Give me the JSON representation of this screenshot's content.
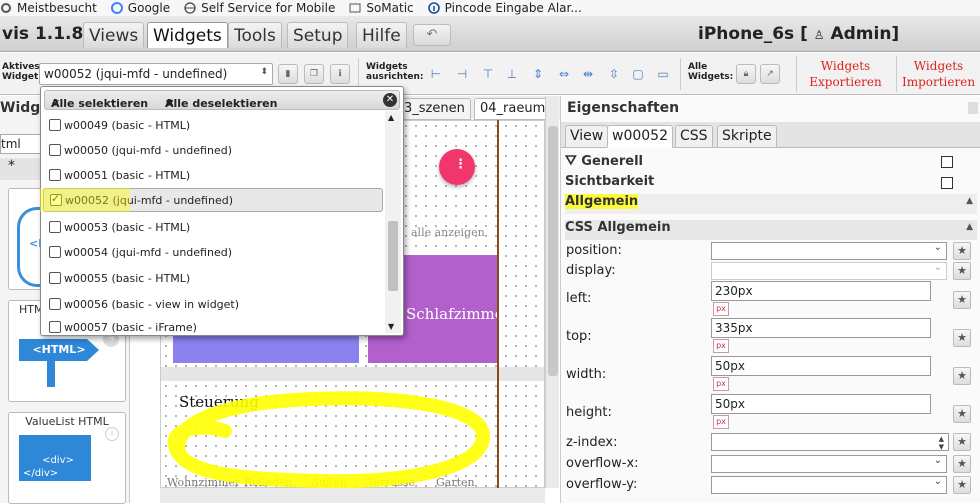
{
  "bookmarks": [
    {
      "label": "Meistbesucht",
      "icon": "gear-icon"
    },
    {
      "label": "Google",
      "icon": "google-icon"
    },
    {
      "label": "Self Service for Mobile",
      "icon": "globe-icon"
    },
    {
      "label": "SoMatic",
      "icon": "folder-icon"
    },
    {
      "label": "Pincode Eingabe Alar...",
      "icon": "info-icon"
    }
  ],
  "app": {
    "title": "vis 1.1.8",
    "menu": [
      "Views",
      "Widgets",
      "Tools",
      "Setup",
      "Hilfe"
    ],
    "active_menu": "Widgets",
    "undo_glyph": "↶",
    "project": "iPhone_6s [",
    "user": "Admin]"
  },
  "toolbar": {
    "active_widget_label_1": "Aktives",
    "active_widget_label_2": "Widget:",
    "active_widget_value": "w00052 (jqui-mfd - undefined)",
    "align_label_1": "Widgets",
    "align_label_2": "ausrichten:",
    "all_widgets_label_1": "Alle",
    "all_widgets_label_2": "Widgets:",
    "export_1": "Widgets",
    "export_2": "Exportieren",
    "import_1": "Widgets",
    "import_2": "Importieren"
  },
  "left_panel": {
    "title": "Widge",
    "filter_value": "tml",
    "star": "*",
    "cards": [
      {
        "label": "",
        "icon_text": "<I"
      },
      {
        "label": "HTM",
        "icon_text": "<HTML>"
      },
      {
        "label": "ValueList HTML",
        "icon_text": "<div>\n</div>"
      }
    ]
  },
  "dropdown": {
    "select_all": "Alle selektieren",
    "deselect_all": "Alle deselektieren",
    "items": [
      {
        "label": "w00049 (basic - HTML)",
        "checked": false
      },
      {
        "label": "w00050 (jqui-mfd - undefined)",
        "checked": false
      },
      {
        "label": "w00051 (basic - HTML)",
        "checked": false
      },
      {
        "label": "w00052 (jqui-mfd - undefined)",
        "checked": true
      },
      {
        "label": "w00053 (basic - HTML)",
        "checked": false
      },
      {
        "label": "w00054 (jqui-mfd - undefined)",
        "checked": false
      },
      {
        "label": "w00055 (basic - HTML)",
        "checked": false
      },
      {
        "label": "w00056 (basic - view in widget)",
        "checked": false
      },
      {
        "label": "w00057 (basic - iFrame)",
        "checked": false
      }
    ]
  },
  "views": {
    "tabs": [
      "3_szenen",
      "04_raeume"
    ]
  },
  "canvas": {
    "show_all": "alle anzeigen",
    "room_label": "Schlafzimme",
    "section_title": "Steuerung",
    "bottom_labels": [
      "Wohnzimmer Rolladen",
      "Außen",
      "Terrasse",
      "Garten"
    ]
  },
  "properties": {
    "title": "Eigenschaften",
    "tabs": [
      "View",
      "w00052",
      "CSS",
      "Skripte"
    ],
    "active_tab": "w00052",
    "groups": {
      "generell": "Generell",
      "sichtbarkeit": "Sichtbarkeit",
      "allgemein": "Allgemein",
      "css_allgemein": "CSS Allgemein"
    },
    "rows": {
      "position": "position:",
      "display": "display:",
      "left": "left:",
      "left_value": "230px",
      "top": "top:",
      "top_value": "335px",
      "width": "width:",
      "width_value": "50px",
      "height": "height:",
      "height_value": "50px",
      "z_index": "z-index:",
      "overflow_x": "overflow-x:",
      "overflow_y": "overflow-y:",
      "unit": "px"
    }
  },
  "colors": {
    "highlight": "#ffff00",
    "accent_red": "#dd2222",
    "fab_pink": "#f0366a",
    "room_purple": "#b160cc",
    "room_blue": "#8b82f0",
    "wood_line": "#8a4b1a"
  }
}
